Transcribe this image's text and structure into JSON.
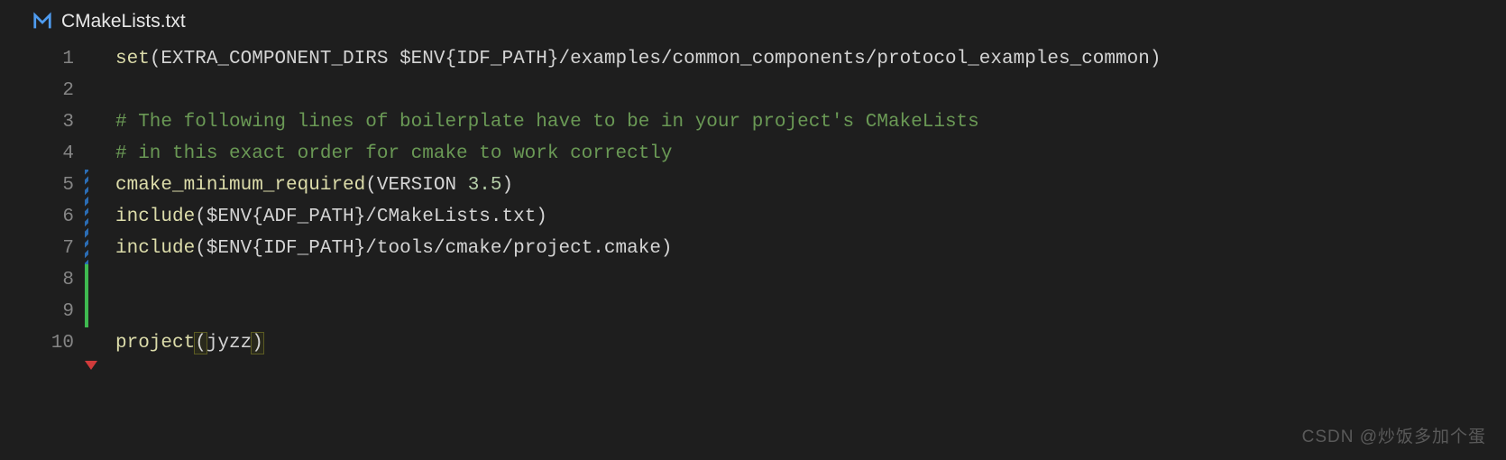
{
  "tab": {
    "icon": "M",
    "filename": "CMakeLists.txt"
  },
  "gutter": {
    "count": 10,
    "diff": {
      "5": "blue",
      "6": "blue",
      "7": "blue",
      "8": "green",
      "9": "green"
    },
    "error_triangle_after_line": 10
  },
  "code": {
    "lines": [
      {
        "n": 1,
        "segments": [
          {
            "t": "set",
            "c": "tok-func"
          },
          {
            "t": "(",
            "c": "tok-paren"
          },
          {
            "t": "EXTRA_COMPONENT_DIRS ",
            "c": "tok-ident"
          },
          {
            "t": "$ENV{IDF_PATH}",
            "c": "tok-var"
          },
          {
            "t": "/examples/common_components/protocol_examples_common",
            "c": "tok-ident"
          },
          {
            "t": ")",
            "c": "tok-paren"
          }
        ]
      },
      {
        "n": 2,
        "segments": []
      },
      {
        "n": 3,
        "segments": [
          {
            "t": "# The following lines of boilerplate have to be in your project's CMakeLists",
            "c": "tok-comment"
          }
        ]
      },
      {
        "n": 4,
        "segments": [
          {
            "t": "# in this exact order for cmake to work correctly",
            "c": "tok-comment"
          }
        ]
      },
      {
        "n": 5,
        "segments": [
          {
            "t": "cmake_minimum_required",
            "c": "tok-func"
          },
          {
            "t": "(",
            "c": "tok-paren"
          },
          {
            "t": "VERSION ",
            "c": "tok-ident"
          },
          {
            "t": "3.5",
            "c": "tok-num"
          },
          {
            "t": ")",
            "c": "tok-paren"
          }
        ]
      },
      {
        "n": 6,
        "segments": [
          {
            "t": "include",
            "c": "tok-func"
          },
          {
            "t": "(",
            "c": "tok-paren"
          },
          {
            "t": "$ENV{ADF_PATH}",
            "c": "tok-var"
          },
          {
            "t": "/CMakeLists.txt",
            "c": "tok-ident"
          },
          {
            "t": ")",
            "c": "tok-paren"
          }
        ]
      },
      {
        "n": 7,
        "segments": [
          {
            "t": "include",
            "c": "tok-func"
          },
          {
            "t": "(",
            "c": "tok-paren"
          },
          {
            "t": "$ENV{IDF_PATH}",
            "c": "tok-var"
          },
          {
            "t": "/tools/cmake/project.cmake",
            "c": "tok-ident"
          },
          {
            "t": ")",
            "c": "tok-paren"
          }
        ]
      },
      {
        "n": 8,
        "segments": []
      },
      {
        "n": 9,
        "segments": []
      },
      {
        "n": 10,
        "segments": [
          {
            "t": "project",
            "c": "tok-func"
          },
          {
            "t": "(",
            "c": "tok-match"
          },
          {
            "t": "jyzz",
            "c": "tok-ident"
          },
          {
            "t": ")",
            "c": "tok-match"
          }
        ]
      }
    ]
  },
  "watermark": "CSDN @炒饭多加个蛋"
}
